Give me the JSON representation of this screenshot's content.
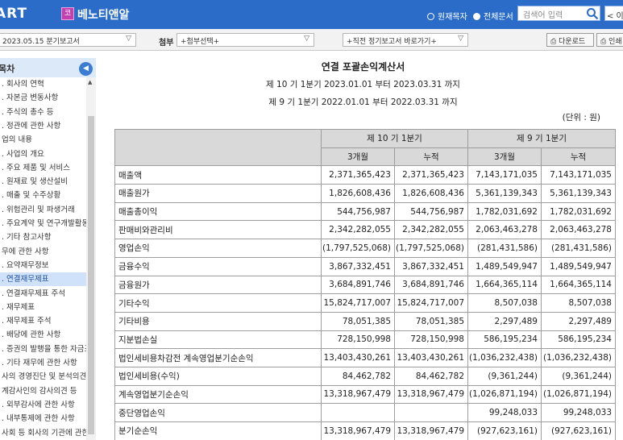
{
  "header": {
    "brand_left": "ART",
    "company_badge": "코",
    "company_name": "베노티앤알",
    "radio_company": "원재목자",
    "radio_all": "전체문서",
    "search_placeholder": "검색어 입력",
    "prev_button": "< 이전"
  },
  "toolbar": {
    "report_select": "2023.05.15  분기보고서",
    "attach_label": "첨부",
    "attach_select": "+첨부선택+",
    "related_select": "+직전 정기보고서 바로가기+",
    "download_button": "다운로드",
    "print_button": "인쇄"
  },
  "sidebar": {
    "title": "목차",
    "collapse_icon": "chevron-left-icon",
    "items": [
      {
        "label": ". 회사의 연혁",
        "active": false
      },
      {
        "label": ". 자본금 변동사항",
        "active": false
      },
      {
        "label": ". 주식의 총수 등",
        "active": false
      },
      {
        "label": ". 정관에 관한 사항",
        "active": false
      },
      {
        "label": "업의 내용",
        "active": false
      },
      {
        "label": ". 사업의 개요",
        "active": false
      },
      {
        "label": ". 주요 제품 및 서비스",
        "active": false
      },
      {
        "label": ". 원재료 및 생산설비",
        "active": false
      },
      {
        "label": ". 매출 및 수주상황",
        "active": false
      },
      {
        "label": ". 위험관리 및 파생거래",
        "active": false
      },
      {
        "label": ". 주요계약 및 연구개발활동",
        "active": false
      },
      {
        "label": ". 기타 참고사항",
        "active": false
      },
      {
        "label": "무에 관한 사항",
        "active": false
      },
      {
        "label": ". 요약재무정보",
        "active": false
      },
      {
        "label": ". 연결재무제표",
        "active": true
      },
      {
        "label": ". 연결재무제표 주석",
        "active": false
      },
      {
        "label": ". 재무제표",
        "active": false
      },
      {
        "label": ". 재무제표 주석",
        "active": false
      },
      {
        "label": ". 배당에 관한 사항",
        "active": false
      },
      {
        "label": ". 증권의 발행을 통한 자금조",
        "active": false
      },
      {
        "label": ". 기타 재무에 관한 사항",
        "active": false
      },
      {
        "label": "사의 경영진단 및 분석의견",
        "active": false
      },
      {
        "label": "계감사인의 감사의견 등",
        "active": false
      },
      {
        "label": ". 외부감사에 관한 사항",
        "active": false
      },
      {
        "label": ". 내부통제에 관한 사항",
        "active": false
      },
      {
        "label": "사회 등 회사의 기관에 관한",
        "active": false
      }
    ]
  },
  "statement": {
    "title": "연결 포괄손익계산서",
    "period1": "제 10 기 1분기 2023.01.01 부터 2023.03.31 까지",
    "period2": "제 9 기 1분기 2022.01.01 부터 2022.03.31 까지",
    "unit": "(단위 : 원)",
    "col_group1": "제 10 기 1분기",
    "col_group2": "제 9 기 1분기",
    "sub_3m": "3개월",
    "sub_cum": "누적",
    "rows": [
      {
        "label": "매출액",
        "values": [
          "2,371,365,423",
          "2,371,365,423",
          "7,143,171,035",
          "7,143,171,035"
        ]
      },
      {
        "label": "매출원가",
        "values": [
          "1,826,608,436",
          "1,826,608,436",
          "5,361,139,343",
          "5,361,139,343"
        ]
      },
      {
        "label": "매출총이익",
        "values": [
          "544,756,987",
          "544,756,987",
          "1,782,031,692",
          "1,782,031,692"
        ]
      },
      {
        "label": "판매비와관리비",
        "values": [
          "2,342,282,055",
          "2,342,282,055",
          "2,063,463,278",
          "2,063,463,278"
        ]
      },
      {
        "label": "영업손익",
        "values": [
          "(1,797,525,068)",
          "(1,797,525,068)",
          "(281,431,586)",
          "(281,431,586)"
        ]
      },
      {
        "label": "금융수익",
        "values": [
          "3,867,332,451",
          "3,867,332,451",
          "1,489,549,947",
          "1,489,549,947"
        ]
      },
      {
        "label": "금융원가",
        "values": [
          "3,684,891,746",
          "3,684,891,746",
          "1,664,365,114",
          "1,664,365,114"
        ]
      },
      {
        "label": "기타수익",
        "values": [
          "15,824,717,007",
          "15,824,717,007",
          "8,507,038",
          "8,507,038"
        ]
      },
      {
        "label": "기타비용",
        "values": [
          "78,051,385",
          "78,051,385",
          "2,297,489",
          "2,297,489"
        ]
      },
      {
        "label": "지분법손실",
        "values": [
          "728,150,998",
          "728,150,998",
          "586,195,234",
          "586,195,234"
        ]
      },
      {
        "label": "법인세비용차감전 계속영업분기순손익",
        "values": [
          "13,403,430,261",
          "13,403,430,261",
          "(1,036,232,438)",
          "(1,036,232,438)"
        ]
      },
      {
        "label": "법인세비용(수익)",
        "values": [
          "84,462,782",
          "84,462,782",
          "(9,361,244)",
          "(9,361,244)"
        ]
      },
      {
        "label": "계속영업분기순손익",
        "values": [
          "13,318,967,479",
          "13,318,967,479",
          "(1,026,871,194)",
          "(1,026,871,194)"
        ]
      },
      {
        "label": "중단영업손익",
        "values": [
          "",
          "",
          "99,248,033",
          "99,248,033"
        ]
      },
      {
        "label": "분기순손익",
        "values": [
          "13,318,967,479",
          "13,318,967,479",
          "(927,623,161)",
          "(927,623,161)"
        ]
      },
      {
        "label": "",
        "values": [
          "",
          "",
          "",
          ""
        ]
      }
    ]
  }
}
